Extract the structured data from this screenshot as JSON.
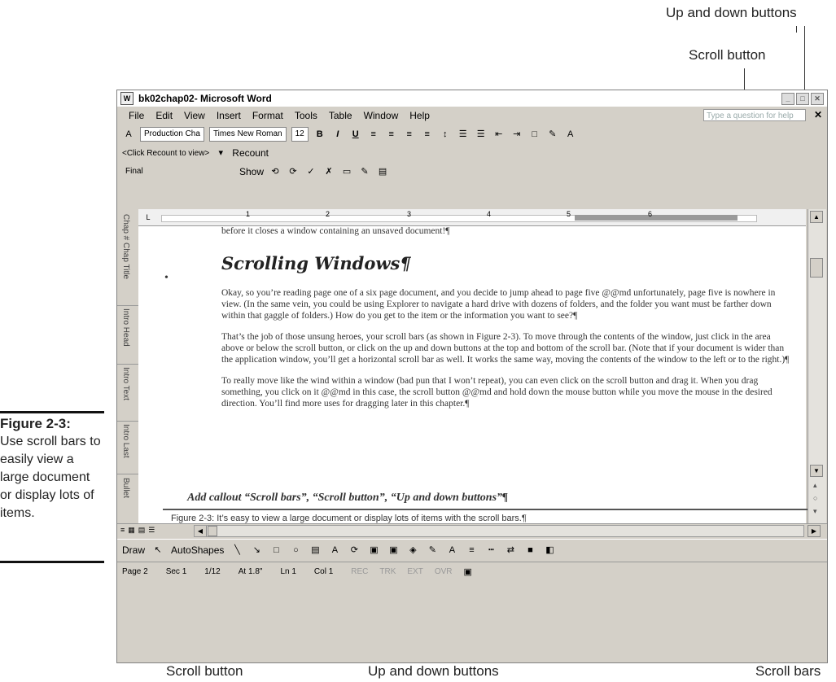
{
  "callouts": {
    "top_up_down": "Up and down buttons",
    "top_scroll_button": "Scroll button",
    "bottom_scroll_button": "Scroll button",
    "bottom_up_down": "Up and down buttons",
    "bottom_scroll_bars": "Scroll bars"
  },
  "figure": {
    "label": "Figure 2-3:",
    "text": "Use scroll bars to easily view a large document or display lots of items."
  },
  "window": {
    "doc_name": "bk02chap02",
    "app_name": " - Microsoft Word",
    "min_icon": "minimize-icon",
    "max_icon": "maximize-icon",
    "close_icon": "close-icon"
  },
  "menu": {
    "items": [
      "File",
      "Edit",
      "View",
      "Insert",
      "Format",
      "Tools",
      "Table",
      "Window",
      "Help"
    ],
    "help_placeholder": "Type a question for help"
  },
  "toolbar1": {
    "style": "Production Cha",
    "font": "Times New Roman",
    "size": "12",
    "bold": "B",
    "italic": "I",
    "underline": "U"
  },
  "toolbar2": {
    "recount_field": "<Click Recount to view>",
    "recount_label": "Recount"
  },
  "toolbar3": {
    "display": "Final",
    "show_label": "Show"
  },
  "ruler": {
    "numbers": [
      "1",
      "2",
      "3",
      "4",
      "5",
      "6"
    ]
  },
  "style_area": {
    "items": [
      "Chap # Chap Title",
      "Intro Head",
      "Intro Text",
      "Intro Last",
      "Bullet"
    ]
  },
  "doc": {
    "line1": "before it closes a window containing an unsaved document!¶",
    "heading": "Scrolling Windows¶",
    "p1": "Okay, so you’re reading page one of a six page document, and you decide to jump ahead to page five @@md unfortunately, page five is nowhere in view. (In the same vein, you could be using Explorer to navigate a hard drive with dozens of folders, and the folder you want must be farther down within that gaggle of folders.) How do you get to the item or the information you want to see?¶",
    "p2": "That’s the job of those unsung heroes, your scroll bars (as shown in Figure 2-3). To move through the contents of the window, just click in the area above or below the scroll button, or click on the up and down buttons at the top and bottom of the scroll bar. (Note that if your document is wider than the application window, you’ll get a horizontal scroll bar as well. It works the same way, moving the contents of the window to the left or to the right.)¶",
    "p3": "To really move like the wind within a window (bad pun that I won’t repeat), you can even click on the scroll button and drag it. When you drag something, you click on it @@md in this case, the scroll button @@md and hold down the mouse button while you move the mouse in the desired direction. You’ll find more uses for dragging later in this chapter.¶",
    "callout_note": "Add callout “Scroll bars”, “Scroll button”, “Up and down buttons”¶",
    "fig_caption": "Figure 2-3: It’s easy to view a large document or display lots of items with the scroll bars.¶"
  },
  "drawbar": {
    "draw": "Draw",
    "autoshapes": "AutoShapes"
  },
  "status": {
    "page": "Page 2",
    "sec": "Sec 1",
    "pages": "1/12",
    "at": "At 1.8\"",
    "ln": "Ln 1",
    "col": "Col 1",
    "rec": "REC",
    "trk": "TRK",
    "ext": "EXT",
    "ovr": "OVR"
  }
}
